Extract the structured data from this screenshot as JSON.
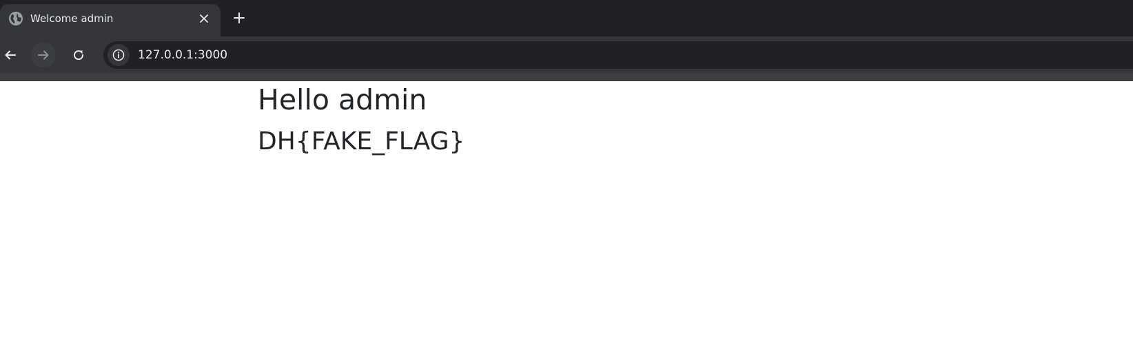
{
  "tab": {
    "title": "Welcome admin",
    "favicon": "globe-icon",
    "close_icon": "close-icon"
  },
  "new_tab_icon": "plus-icon",
  "toolbar": {
    "back_icon": "arrow-left-icon",
    "forward_icon": "arrow-right-icon",
    "reload_icon": "reload-icon",
    "site_info_icon": "info-icon",
    "url": "127.0.0.1:3000"
  },
  "page": {
    "greeting": "Hello admin",
    "flag": "DH{FAKE_FLAG}"
  },
  "colors": {
    "tabstrip_bg": "#202124",
    "toolbar_bg": "#35363a",
    "omnibox_bg": "#202124",
    "text_light": "#e8eaed",
    "page_text": "#212529",
    "page_bg": "#ffffff"
  }
}
